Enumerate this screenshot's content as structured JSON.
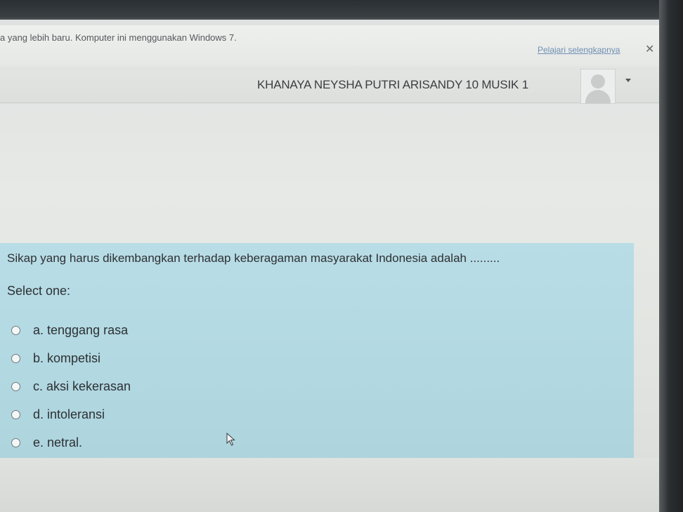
{
  "notification": {
    "message": "a yang lebih baru. Komputer ini menggunakan Windows 7.",
    "learn_more_label": "Pelajari selengkapnya",
    "close_glyph": "✕"
  },
  "header": {
    "user_name": "KHANAYA NEYSHA PUTRI ARISANDY 10 MUSIK 1",
    "avatar_icon": "user-avatar-placeholder",
    "menu_icon": "caret-down-icon"
  },
  "quiz": {
    "question": "Sikap yang harus dikembangkan terhadap keberagaman masyarakat Indonesia adalah .........",
    "prompt": "Select one:",
    "options": [
      {
        "label": "a. tenggang rasa",
        "selected": false
      },
      {
        "label": "b. kompetisi",
        "selected": false
      },
      {
        "label": "c. aksi kekerasan",
        "selected": false
      },
      {
        "label": "d. intoleransi",
        "selected": false
      },
      {
        "label": "e. netral.",
        "selected": false
      }
    ]
  },
  "colors": {
    "question_background": "#b6dbe4",
    "link": "#6f8fb3",
    "text": "#2c3133"
  }
}
